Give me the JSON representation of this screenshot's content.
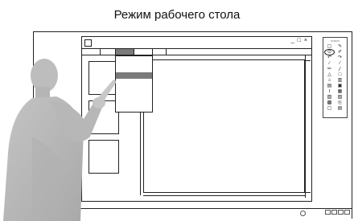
{
  "caption": "Режим рабочего стола",
  "window": {
    "controls": [
      "_",
      "□",
      "×"
    ]
  },
  "palette": {
    "header": "▭▭▭",
    "tools": [
      "▢",
      "✎",
      "⊙",
      "✐",
      "↶",
      "↷",
      "⁄",
      "∕",
      "✏",
      "╱",
      "△",
      "□",
      "⌂",
      "▥",
      "▤",
      "▣",
      "T",
      "▦",
      "▧",
      "▨",
      "▩",
      "⎘",
      "▢",
      "▤"
    ]
  },
  "tray": {
    "buttons": 4
  }
}
